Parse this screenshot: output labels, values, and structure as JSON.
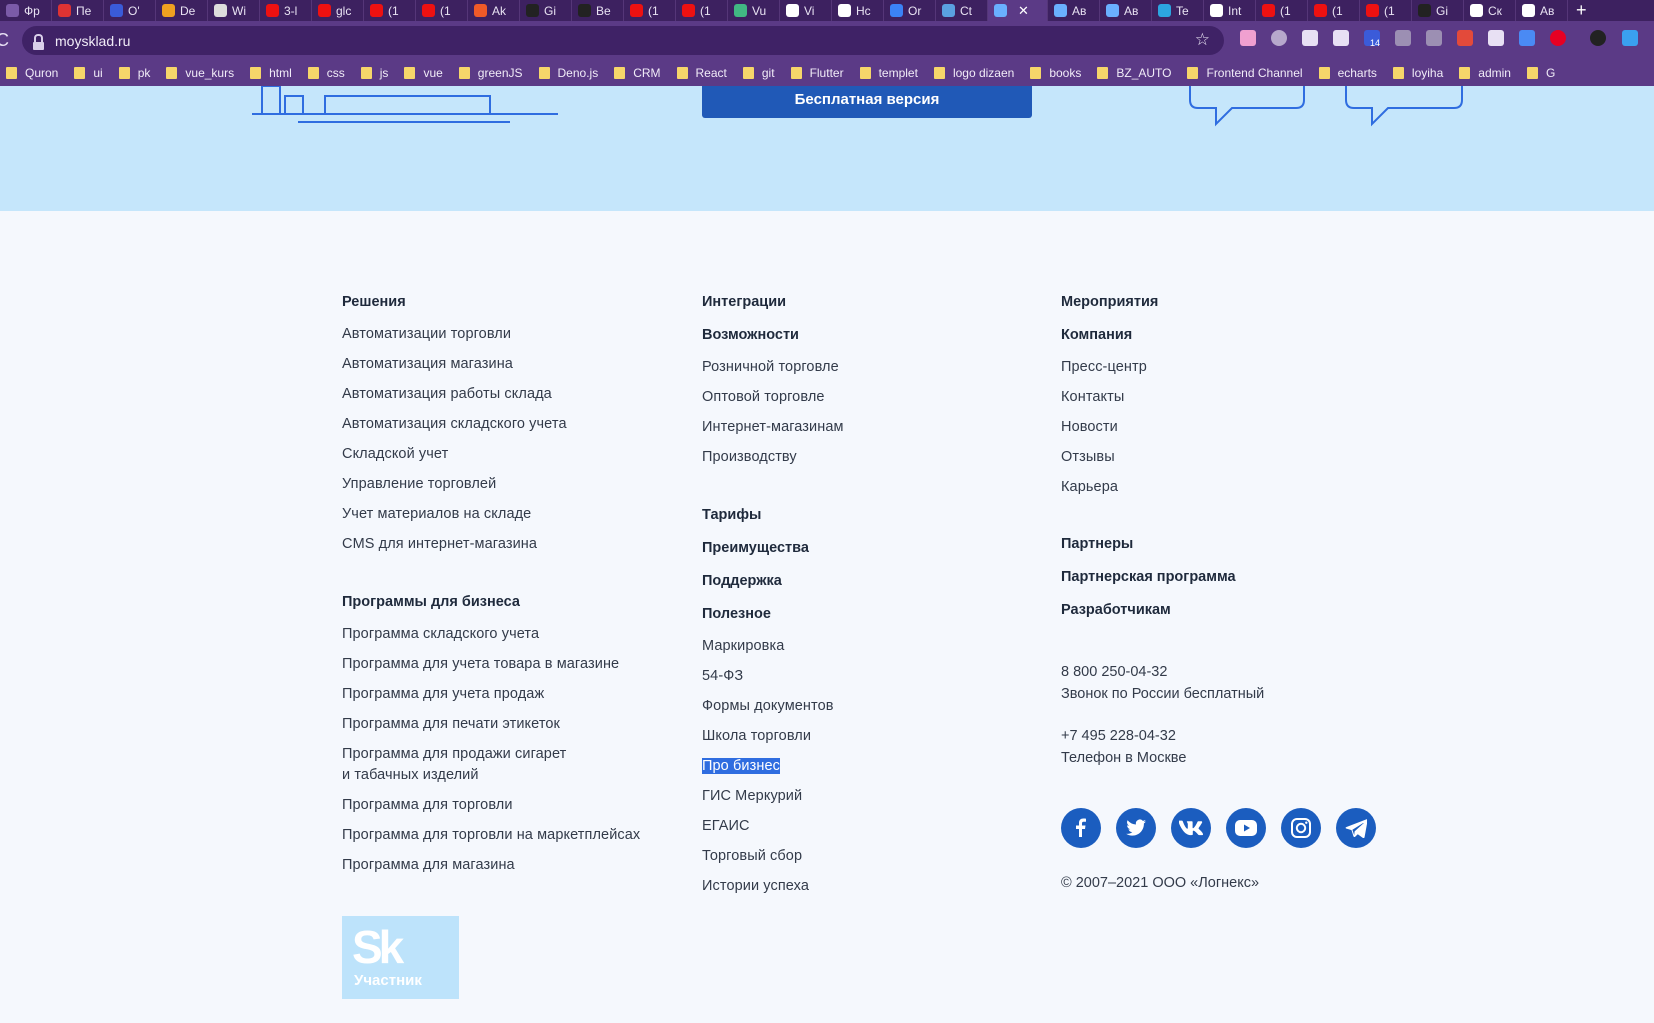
{
  "browser": {
    "tabs": [
      {
        "label": "Фр",
        "color": "#7b5aa8"
      },
      {
        "label": "Пе",
        "color": "#d33"
      },
      {
        "label": "O'",
        "color": "#3a5bd9"
      },
      {
        "label": "De",
        "color": "#f0a020"
      },
      {
        "label": "Wi",
        "color": "#ddd"
      },
      {
        "label": "3-l",
        "color": "#e11"
      },
      {
        "label": "glc",
        "color": "#e11"
      },
      {
        "label": "(1",
        "color": "#e11"
      },
      {
        "label": "(1",
        "color": "#e11"
      },
      {
        "label": "Ak",
        "color": "#f05a28"
      },
      {
        "label": "Gi",
        "color": "#222"
      },
      {
        "label": "Be",
        "color": "#222"
      },
      {
        "label": "(1",
        "color": "#e11"
      },
      {
        "label": "(1",
        "color": "#e11"
      },
      {
        "label": "Vu",
        "color": "#41b883"
      },
      {
        "label": "Vi",
        "color": "#fff"
      },
      {
        "label": "Hc",
        "color": "#fff"
      },
      {
        "label": "Or",
        "color": "#3b82f6"
      },
      {
        "label": "Ct",
        "color": "#5aa0e0"
      },
      {
        "label": "",
        "color": "#6ab0ff",
        "active": true
      },
      {
        "label": "Ав",
        "color": "#6ab0ff"
      },
      {
        "label": "Ав",
        "color": "#6ab0ff"
      },
      {
        "label": "Te",
        "color": "#2ca5e0"
      },
      {
        "label": "Int",
        "color": "#fff"
      },
      {
        "label": "(1",
        "color": "#e11"
      },
      {
        "label": "(1",
        "color": "#e11"
      },
      {
        "label": "(1",
        "color": "#e11"
      },
      {
        "label": "Gi",
        "color": "#222"
      },
      {
        "label": "Ск",
        "color": "#fff"
      },
      {
        "label": "Ав",
        "color": "#fff"
      }
    ],
    "new_tab": "+",
    "url": "moysklad.ru",
    "reload": "C",
    "star": "☆",
    "bookmarks": [
      "Quron",
      "ui",
      "pk",
      "vue_kurs",
      "html",
      "css",
      "js",
      "vue",
      "greenJS",
      "Deno.js",
      "CRM",
      "React",
      "git",
      "Flutter",
      "templet",
      "logo dizaen",
      "books",
      "BZ_AUTO",
      "Frontend Channel",
      "echarts",
      "loyiha",
      "admin",
      "G"
    ],
    "extension_badge": "14"
  },
  "hero": {
    "cta_label": "Бесплатная версия"
  },
  "footer": {
    "col1": {
      "heading1": "Решения",
      "links1": [
        "Автоматизации торговли",
        "Автоматизация магазина",
        "Автоматизация работы склада",
        "Автоматизация складского учета",
        "Складской учет",
        "Управление торговлей",
        "Учет материалов на складе",
        "CMS для интернет-магазина"
      ],
      "heading2": "Программы для бизнеса",
      "links2": [
        "Программа складского учета",
        "Программа для учета товара в магазине",
        "Программа для учета продаж",
        "Программа для печати этикеток",
        "Программа для продажи сигарет",
        "и табачных изделий",
        "Программа для торговли",
        "Программа для торговли на маркетплейсах",
        "Программа для магазина"
      ],
      "badge_logo": "Sk",
      "badge_text": "Участник"
    },
    "col2": {
      "heading_integrations": "Интеграции",
      "heading_features": "Возможности",
      "links_features": [
        "Розничной торговле",
        "Оптовой торговле",
        "Интернет-магазинам",
        "Производству"
      ],
      "heading_tariffs": "Тарифы",
      "heading_advantages": "Преимущества",
      "heading_support": "Поддержка",
      "heading_useful": "Полезное",
      "links_useful": [
        "Маркировка",
        "54-ФЗ",
        "Формы документов",
        "Школа торговли",
        "Про бизнес",
        "ГИС Меркурий",
        "ЕГАИС",
        "Торговый сбор",
        "Истории успеха"
      ]
    },
    "col3": {
      "heading_events": "Мероприятия",
      "heading_company": "Компания",
      "links_company": [
        "Пресс-центр",
        "Контакты",
        "Новости",
        "Отзывы",
        "Карьера"
      ],
      "heading_partners": "Партнеры",
      "heading_partner_program": "Партнерская программа",
      "heading_developers": "Разработчикам",
      "phone1": "8 800 250-04-32",
      "phone1_note": "Звонок по России бесплатный",
      "phone2": "+7 495 228-04-32",
      "phone2_note": "Телефон в Москве",
      "socials": [
        "facebook-icon",
        "twitter-icon",
        "vk-icon",
        "youtube-icon",
        "instagram-icon",
        "telegram-icon"
      ],
      "copyright": "© 2007–2021 ООО «Логнекс»"
    }
  }
}
